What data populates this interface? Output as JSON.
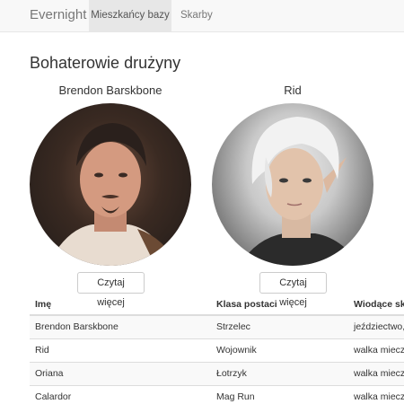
{
  "navbar": {
    "brand": "Evernight",
    "items": [
      {
        "label": "Mieszkańcy bazy",
        "active": true
      },
      {
        "label": "Skarby",
        "active": false
      }
    ]
  },
  "main": {
    "heading": "Bohaterowie drużyny",
    "heroes": [
      {
        "name": "Brendon Barskbone",
        "button_label": "Czytaj więcej"
      },
      {
        "name": "Rid",
        "button_label": "Czytaj więcej"
      }
    ],
    "table": {
      "headers": [
        "Imę",
        "Klasa postaci",
        "Wiodące skil"
      ],
      "rows": [
        [
          "Brendon Barskbone",
          "Strzelec",
          "jeździectwo, s"
        ],
        [
          "Rid",
          "Wojownik",
          "walka miecze"
        ],
        [
          "Oriana",
          "Łotrzyk",
          "walka miecze"
        ],
        [
          "Calardor",
          "Mag Run",
          "walka miecze"
        ]
      ]
    }
  }
}
